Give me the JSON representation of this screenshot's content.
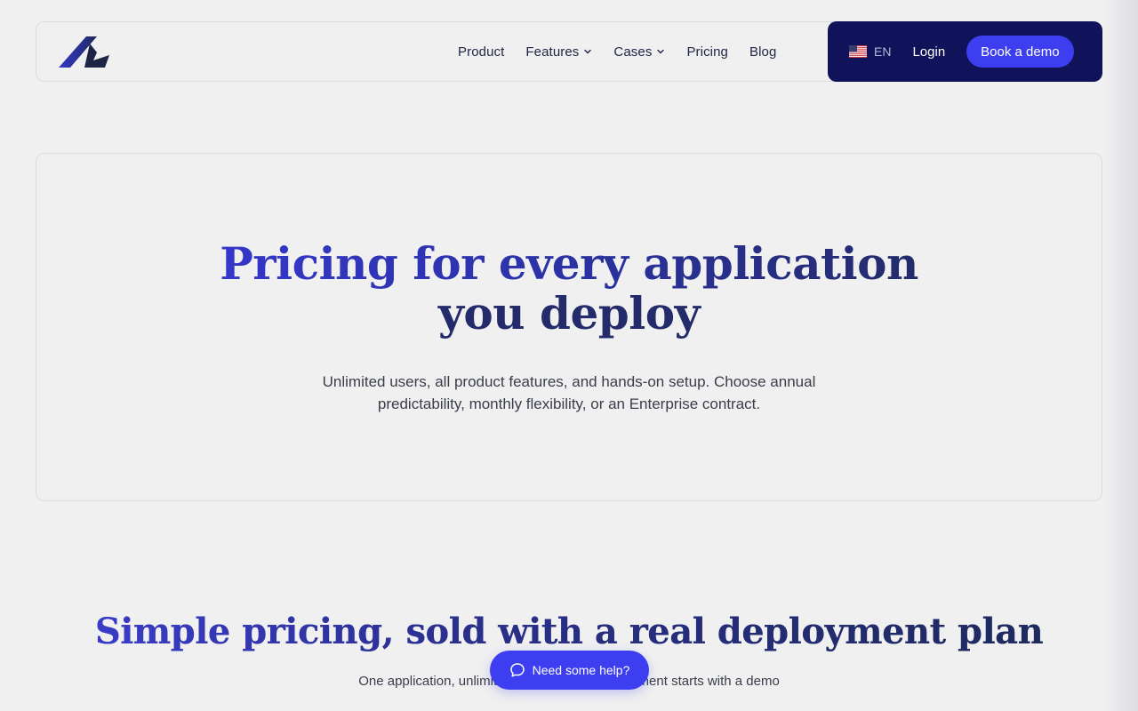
{
  "nav": {
    "links": [
      {
        "label": "Product"
      },
      {
        "label": "Features"
      },
      {
        "label": "Cases"
      },
      {
        "label": "Pricing"
      },
      {
        "label": "Blog"
      }
    ],
    "language": "EN",
    "login_label": "Login",
    "demo_label": "Book a demo"
  },
  "hero": {
    "title_line1": "Pricing for every application",
    "title_line2": "you deploy",
    "subtitle_line1": "Unlimited users, all product features, and hands-on setup. Choose annual",
    "subtitle_line2": "predictability, monthly flexibility, or an Enterprise contract."
  },
  "section": {
    "title": "Simple pricing, sold with a real deployment plan",
    "subtitle": "One application, unlimited users. Every engagement starts with a demo"
  },
  "help": {
    "label": "Need some help?"
  },
  "colors": {
    "accent": "#3c3ef0",
    "nav_dark": "#10135a",
    "heading_dark": "#232b6a",
    "heading_blue": "#3437c8",
    "background": "#f0f0f1"
  },
  "icons": [
    "logo-icon",
    "chevron-down-icon",
    "us-flag-icon",
    "chat-bubble-icon"
  ]
}
